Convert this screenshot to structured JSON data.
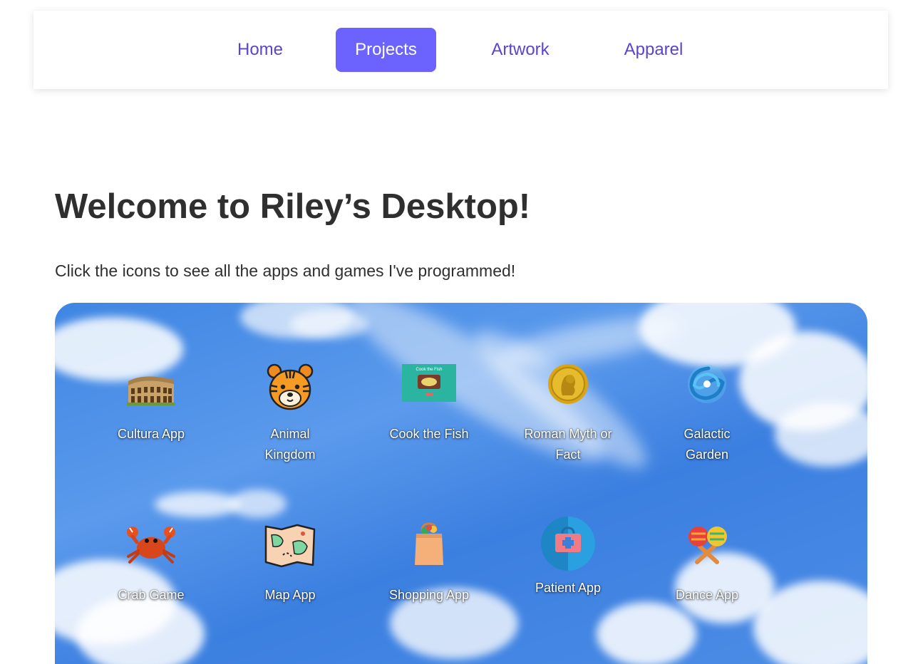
{
  "nav": {
    "items": [
      {
        "label": "Home",
        "active": false
      },
      {
        "label": "Projects",
        "active": true
      },
      {
        "label": "Artwork",
        "active": false
      },
      {
        "label": "Apparel",
        "active": false
      }
    ]
  },
  "main": {
    "title": "Welcome to Riley’s Desktop!",
    "subtitle": "Click the icons to see all the apps and games I've programmed!"
  },
  "desktop": {
    "apps": [
      {
        "label": "Cultura App",
        "icon": "colosseum-icon"
      },
      {
        "label": "Animal Kingdom",
        "icon": "tiger-icon"
      },
      {
        "label": "Cook the Fish",
        "icon": "cook-the-fish-thumbnail-icon",
        "thumb_title": "Cook the Fish"
      },
      {
        "label": "Roman Myth or Fact",
        "icon": "gold-coin-icon"
      },
      {
        "label": "Galactic Garden",
        "icon": "galaxy-icon"
      },
      {
        "label": "Crab Game",
        "icon": "crab-icon"
      },
      {
        "label": "Map App",
        "icon": "map-icon"
      },
      {
        "label": "Shopping App",
        "icon": "shopping-bag-icon"
      },
      {
        "label": "Patient App",
        "icon": "medical-kit-icon"
      },
      {
        "label": "Dance App",
        "icon": "maracas-icon"
      }
    ]
  },
  "colors": {
    "accent": "#6c63ff",
    "nav_text": "#5a45cf",
    "sky": "#3f86e3"
  }
}
